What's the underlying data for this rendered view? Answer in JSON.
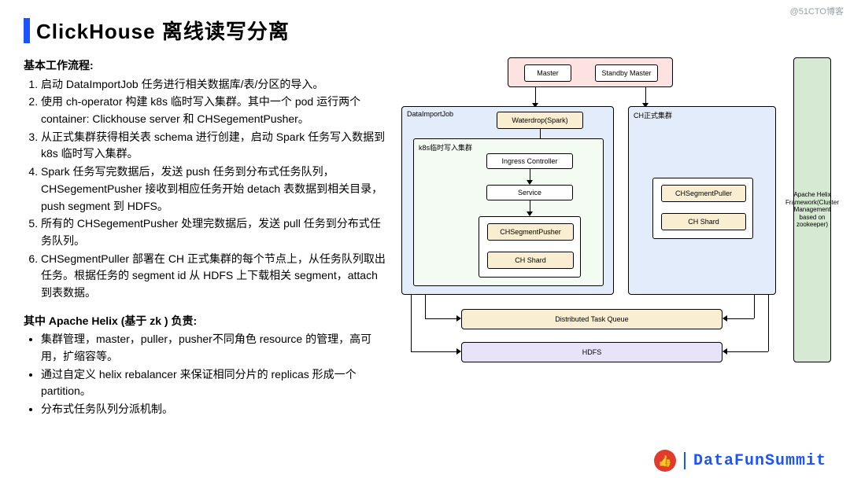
{
  "title": "ClickHouse 离线读写分离",
  "workflow": {
    "heading": "基本工作流程:",
    "steps": [
      "启动 DataImportJob 任务进行相关数据库/表/分区的导入。",
      "使用 ch-operator 构建 k8s 临时写入集群。其中一个 pod 运行两个 container: Clickhouse server 和 CHSegementPusher。",
      "从正式集群获得相关表 schema 进行创建，启动 Spark 任务写入数据到 k8s 临时写入集群。",
      "Spark 任务写完数据后，发送 push 任务到分布式任务队列，CHSegementPusher 接收到相应任务开始 detach 表数据到相关目录，push segment 到 HDFS。",
      "所有的 CHSegementPusher 处理完数据后，发送 pull 任务到分布式任务队列。",
      "CHSegmentPuller 部署在 CH 正式集群的每个节点上，从任务队列取出任务。根据任务的 segment id 从 HDFS 上下载相关 segment，attach 到表数据。"
    ]
  },
  "helix": {
    "heading": "其中 Apache Helix (基于 zk ) 负责:",
    "items": [
      "集群管理，master，puller，pusher不同角色 resource 的管理，高可用，扩缩容等。",
      "通过自定义 helix rebalancer 来保证相同分片的 replicas 形成一个 partition。",
      "分布式任务队列分派机制。"
    ]
  },
  "diagram": {
    "master": "Master",
    "standby": "Standby Master",
    "dataimport_panel": "DataImportJob",
    "waterdrop": "Waterdrop(Spark)",
    "k8s_panel": "k8s临时写入集群",
    "ingress": "Ingress Controller",
    "service": "Service",
    "ch_pusher": "CHSegmentPusher",
    "ch_shard_left": "CH Shard",
    "ch_cluster_panel": "CH正式集群",
    "ch_puller": "CHSegmentPuller",
    "ch_shard_right": "CH Shard",
    "dtq": "Distributed Task Queue",
    "hdfs": "HDFS",
    "helix_box": "Apache Helix Framework(Cluster Management based on zookeeper)"
  },
  "footer": {
    "brand": "DataFunSummit",
    "thumb_icon": "👍"
  },
  "watermark": "@51CTO博客"
}
